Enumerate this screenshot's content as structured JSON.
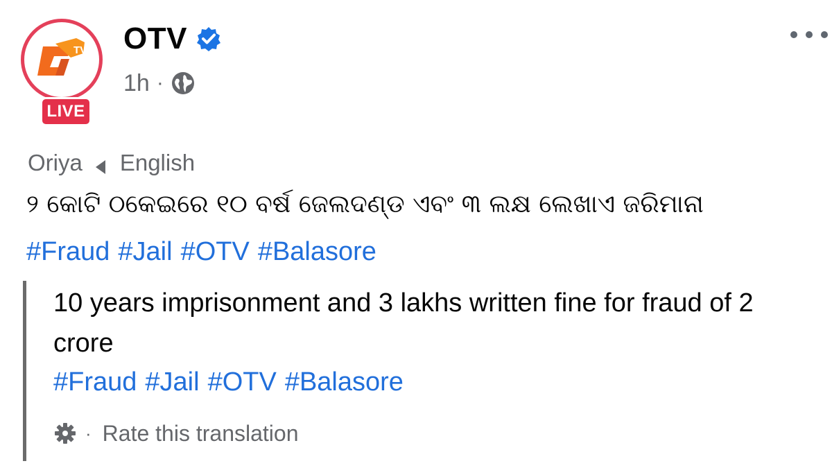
{
  "post": {
    "author": {
      "name": "OTV",
      "live_badge": "LIVE",
      "logo_text": "TV",
      "verified": true
    },
    "time": "1h",
    "audience_icon": "globe-icon",
    "more_icon": "more-options-icon",
    "translation": {
      "source_language": "Oriya",
      "target_language": "English"
    },
    "original_text": "୨ କୋଟି ଠକେଇରେ ୧୦ ବର୍ଷ ଜେଲଦଣ୍ଡ ଏବଂ ୩ ଲକ୍ଷ ଲେଖାଏ ଜରିମାନା",
    "hashtags": [
      "#Fraud",
      "#Jail",
      "#OTV",
      "#Balasore"
    ],
    "translated_text": "10 years imprisonment and 3 lakhs written fine for fraud of 2 crore",
    "translated_hashtags": [
      "#Fraud",
      "#Jail",
      "#OTV",
      "#Balasore"
    ],
    "rate_translation_label": "Rate this translation"
  },
  "colors": {
    "live_red": "#e4304a",
    "ring_red": "#e4405a",
    "hashtag_blue": "#216fdb",
    "verified_blue": "#1b74e4",
    "muted_gray": "#65676b",
    "logo_orange": "#f26b1d"
  }
}
